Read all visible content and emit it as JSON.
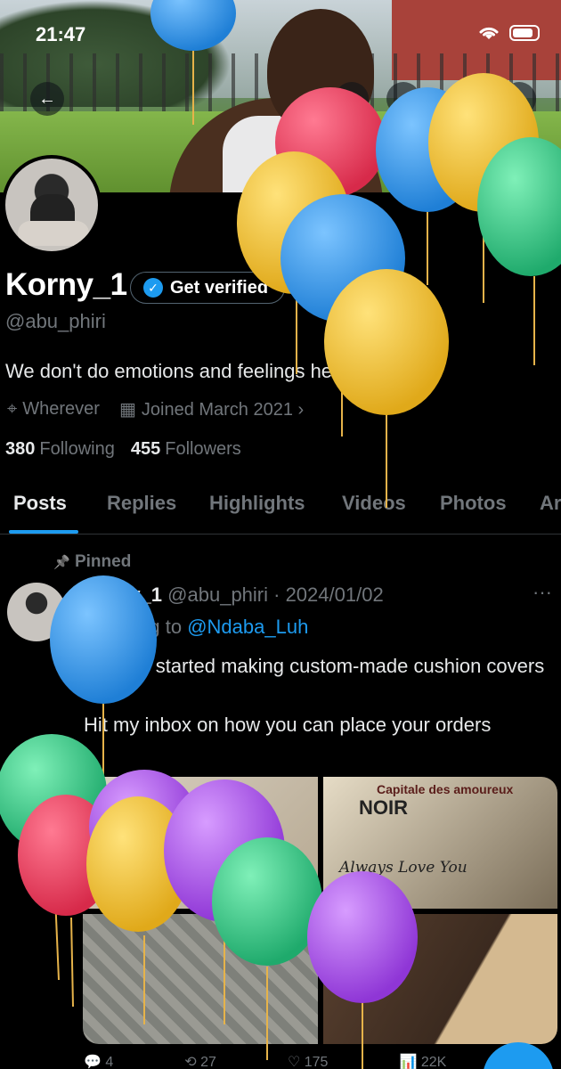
{
  "status": {
    "time": "21:47"
  },
  "header": {
    "back_icon": "←",
    "mute_icon": "⦸",
    "search_icon": "⌕",
    "gem_icon": "◇",
    "share_icon": "⇪"
  },
  "profile": {
    "name": "Korny_1",
    "verify_label": "Get verified",
    "verify_check": "✓",
    "handle": "@abu_phiri",
    "bio": "We don't do emotions and feelings here",
    "location_icon": "⌖",
    "location": "Wherever",
    "joined_icon": "▦",
    "joined": "Joined March 2021",
    "joined_chevron": "›",
    "following_count": "380",
    "following_label": "Following",
    "followers_count": "455",
    "followers_label": "Followers"
  },
  "tabs": [
    {
      "label": "Posts"
    },
    {
      "label": "Replies"
    },
    {
      "label": "Highlights"
    },
    {
      "label": "Videos"
    },
    {
      "label": "Photos"
    },
    {
      "label": "Ar"
    }
  ],
  "post": {
    "pinned_icon": "📌",
    "pinned_label": "Pinned",
    "author": "Korny_1",
    "handle_date": "@abu_phiri · 2024/01/02",
    "more": "···",
    "replying_prefix": "Replying to",
    "mention": "@Ndaba_Luh",
    "text_line1": "Already started making custom-made cushion covers",
    "text_line2": "Hit my inbox on how you can place your orders",
    "media_caption_top": "Capitale des amoureux",
    "media_noir": "NOIR",
    "media_love": "Always Love You"
  },
  "post_actions": [
    {
      "icon": "💬",
      "count": "4"
    },
    {
      "icon": "⟲",
      "count": "27"
    },
    {
      "icon": "♡",
      "count": "175"
    },
    {
      "icon": "📊",
      "count": "22K"
    }
  ],
  "colors": {
    "accent": "#1d9bf0",
    "muted": "#71767b",
    "text": "#e7e9ea",
    "background": "#000000"
  }
}
